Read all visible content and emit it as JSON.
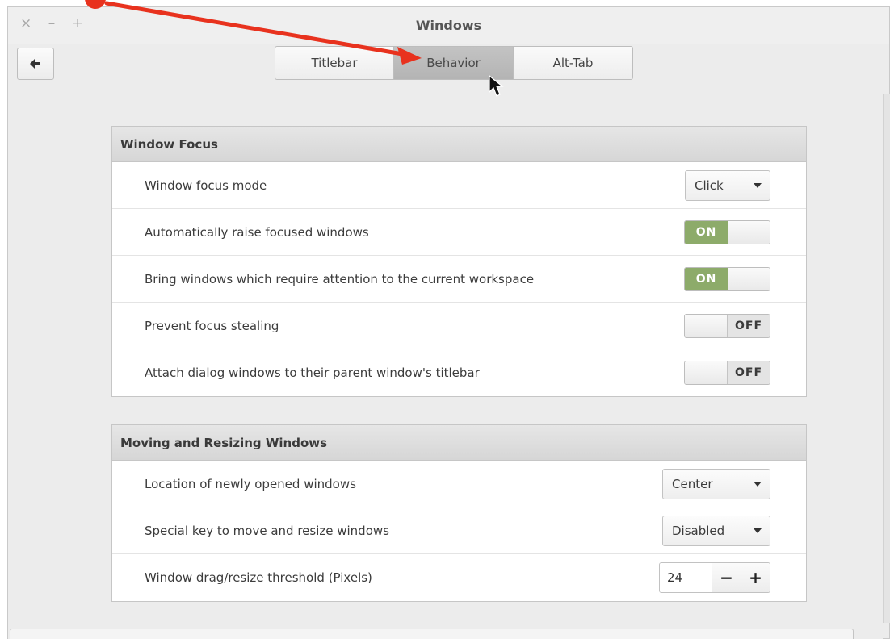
{
  "window": {
    "title": "Windows",
    "controls": {
      "close": "×",
      "minimize": "–",
      "maximize": "+"
    }
  },
  "toolbar": {
    "back_icon": "back-arrow-icon",
    "tabs": [
      {
        "label": "Titlebar",
        "active": false
      },
      {
        "label": "Behavior",
        "active": true
      },
      {
        "label": "Alt-Tab",
        "active": false
      }
    ]
  },
  "sections": [
    {
      "title": "Window Focus",
      "rows": [
        {
          "label": "Window focus mode",
          "control": "combo",
          "value": "Click"
        },
        {
          "label": "Automatically raise focused windows",
          "control": "switch",
          "value": "ON"
        },
        {
          "label": "Bring windows which require attention to the current workspace",
          "control": "switch",
          "value": "ON"
        },
        {
          "label": "Prevent focus stealing",
          "control": "switch",
          "value": "OFF"
        },
        {
          "label": "Attach dialog windows to their parent window's titlebar",
          "control": "switch",
          "value": "OFF"
        }
      ]
    },
    {
      "title": "Moving and Resizing Windows",
      "rows": [
        {
          "label": "Location of newly opened windows",
          "control": "combo",
          "value": "Center"
        },
        {
          "label": "Special key to move and resize windows",
          "control": "combo",
          "value": "Disabled"
        },
        {
          "label": "Window drag/resize threshold (Pixels)",
          "control": "spin",
          "value": "24",
          "minus": "−",
          "plus": "+"
        }
      ]
    }
  ],
  "colors": {
    "switch_on": "#8dab6a",
    "annotation_arrow": "#e8321e",
    "active_tab": "#b9b9b9"
  }
}
